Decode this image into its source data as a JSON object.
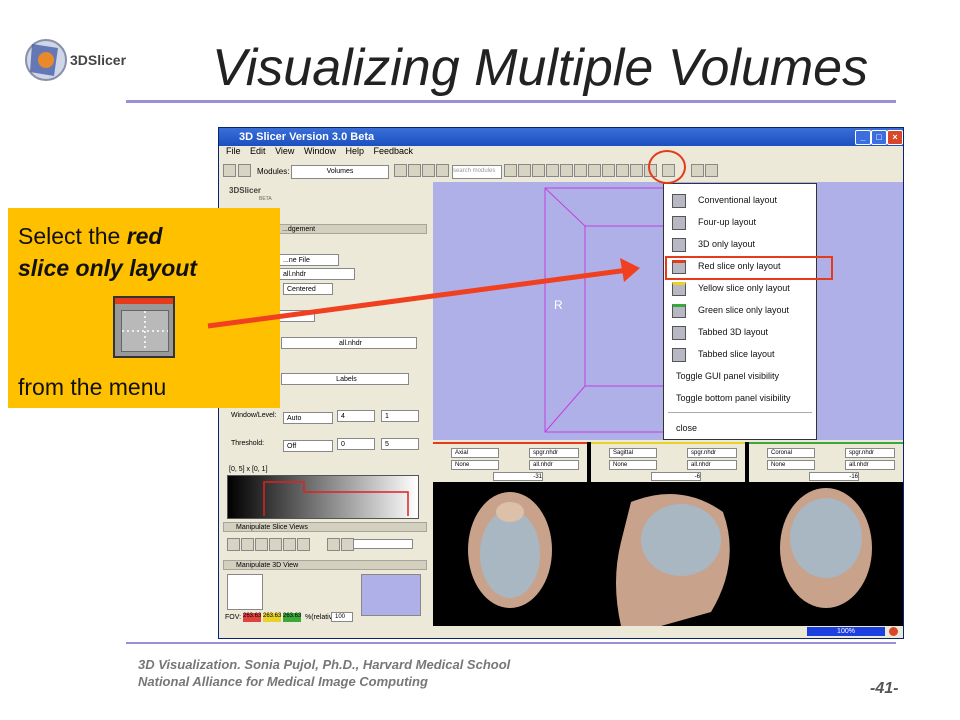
{
  "slide": {
    "logo_text": "3DSlicer",
    "title": "Visualizing Multiple Volumes",
    "footer_line1": "3D Visualization. Sonia Pujol, Ph.D., Harvard Medical School",
    "footer_line2": "National Alliance for Medical Image Computing",
    "page_number": "-41-"
  },
  "callout": {
    "line1_prefix": "Select the ",
    "line1_bold": "red",
    "line2_bold": "slice only layout",
    "line3": "from the menu",
    "color": "#ffc000"
  },
  "app": {
    "window_title": "3D Slicer Version 3.0 Beta",
    "menu": [
      "File",
      "Edit",
      "View",
      "Window",
      "Help",
      "Feedback"
    ],
    "modules_label": "Modules:",
    "modules_value": "Volumes",
    "search_placeholder": "search modules",
    "logo": "3DSlicer",
    "logo_sub": "BETA",
    "left_panel": {
      "acknowledgement": "...dgement",
      "file_button": "...ne File",
      "file_name": "all.nhdr",
      "centered": "Centered",
      "active_volume": "all.nhdr",
      "lut": "Labels",
      "window_level_label": "Window/Level:",
      "window_level_mode": "Auto",
      "window_value": "4",
      "level_value": "1",
      "threshold_label": "Threshold:",
      "threshold_mode": "Off",
      "threshold_low": "0",
      "threshold_high": "5",
      "range_text": "[0, 5] x [0, 1]",
      "manipulate_slice": "Manipulate Slice Views",
      "manipulate_3d": "Manipulate 3D View",
      "fov_label": "FOV:",
      "fov_values": [
        "263.63",
        "263.63",
        "263.63"
      ],
      "relative_label": "%(relative):",
      "relative_value": "100"
    },
    "view3d_label": "R",
    "slices": [
      {
        "name": "Axial",
        "bg": "spgr.nhdr",
        "fg": "None",
        "lb": "all.nhdr",
        "offset": "-31",
        "color": "#e53b1b"
      },
      {
        "name": "Sagittal",
        "bg": "spgr.nhdr",
        "fg": "None",
        "lb": "all.nhdr",
        "offset": "-6",
        "color": "#e8d22a"
      },
      {
        "name": "Coronal",
        "bg": "spgr.nhdr",
        "fg": "None",
        "lb": "all.nhdr",
        "offset": "-16",
        "color": "#3aa83a"
      }
    ],
    "progress_text": "100%"
  },
  "layout_menu": {
    "items": [
      "Conventional layout",
      "Four-up layout",
      "3D only layout",
      "Red slice only layout",
      "Yellow slice only layout",
      "Green slice only layout",
      "Tabbed 3D layout",
      "Tabbed slice layout",
      "Toggle GUI panel visibility",
      "Toggle bottom panel visibility",
      "close"
    ],
    "highlight_color": "#e53b1b"
  }
}
